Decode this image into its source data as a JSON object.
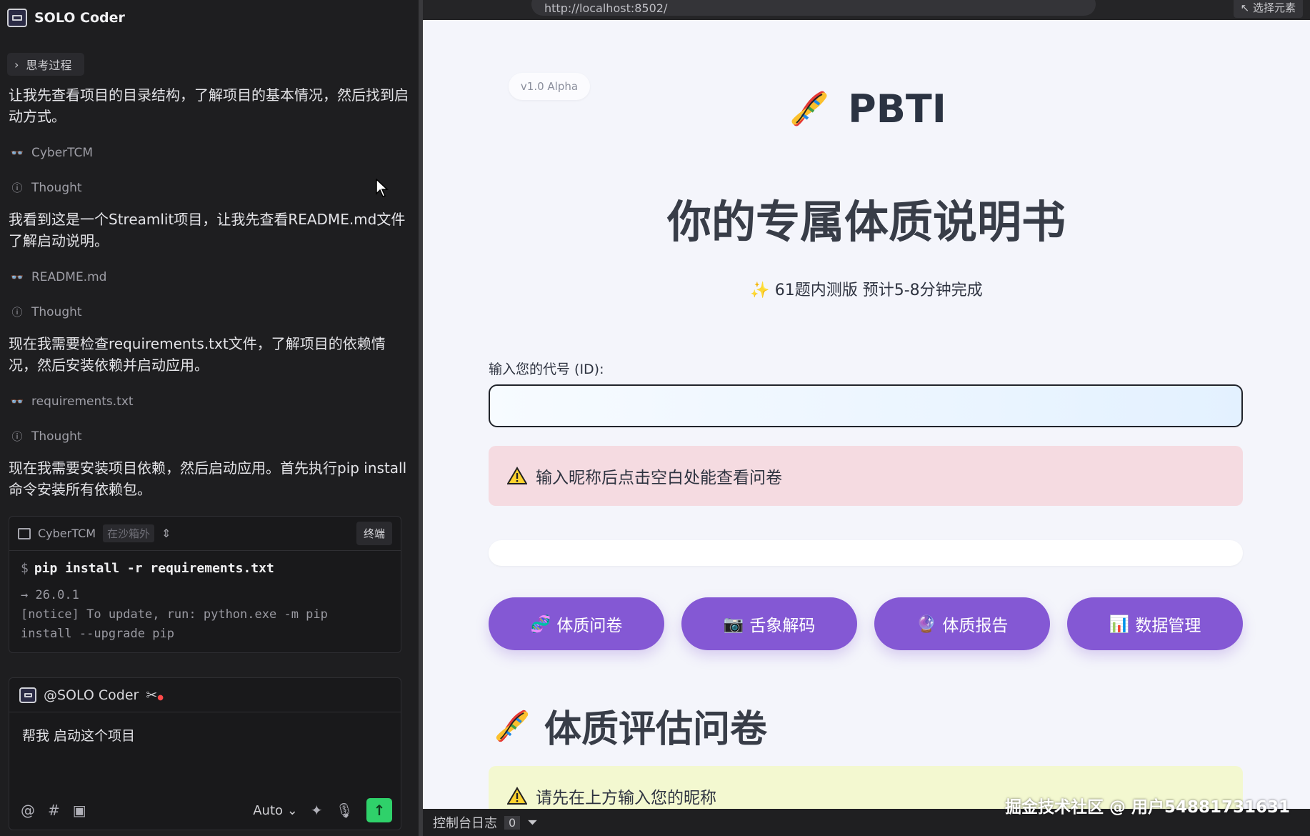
{
  "left": {
    "title": "SOLO Coder",
    "think_tag": "思考过程",
    "para1": "让我先查看项目的目录结构，了解项目的基本情况，然后找到启动方式。",
    "step1": "CyberTCM",
    "thought1": "Thought",
    "para2": "我看到这是一个Streamlit项目，让我先查看README.md文件了解启动说明。",
    "step2": "README.md",
    "thought2": "Thought",
    "para3": "现在我需要检查requirements.txt文件，了解项目的依赖情况，然后安装依赖并启动应用。",
    "step3": "requirements.txt",
    "thought3": "Thought",
    "para4": "现在我需要安装项目依赖，然后启动应用。首先执行pip install命令安装所有依赖包。",
    "terminal": {
      "name": "CyberTCM",
      "badge": "在沙箱外",
      "button": "终端",
      "prompt": "$",
      "command": "pip install -r requirements.txt",
      "out1": "→ 26.0.1",
      "out2": "[notice] To update, run: python.exe -m pip",
      "out3": "install --upgrade pip"
    },
    "chat": {
      "agent": "@SOLO Coder",
      "message": "帮我 启动这个项目",
      "at": "@",
      "hash": "#",
      "mode": "Auto"
    }
  },
  "browser": {
    "url": "http://localhost:8502/",
    "select_btn": "选择元素",
    "page": {
      "version": "v1.0 Alpha",
      "brand": "PBTI",
      "hero": "你的专属体质说明书",
      "subtitle": "61题内测版 预计5-8分钟完成",
      "id_label": "输入您的代号 (ID):",
      "warning1": "输入昵称后点击空白处能查看问卷",
      "buttons": [
        "体质问卷",
        "舌象解码",
        "体质报告",
        "数据管理"
      ],
      "section_title": "体质评估问卷",
      "warning2": "请先在上方输入您的昵称"
    },
    "console": {
      "label": "控制台日志",
      "count": "0"
    },
    "watermark": "掘金技术社区 @ 用户54881731631"
  },
  "colors": {
    "accent": "#8458d4",
    "send": "#2fd16a",
    "warn_pink": "#f5dbe1",
    "warn_yellow": "#f3f8d0"
  }
}
